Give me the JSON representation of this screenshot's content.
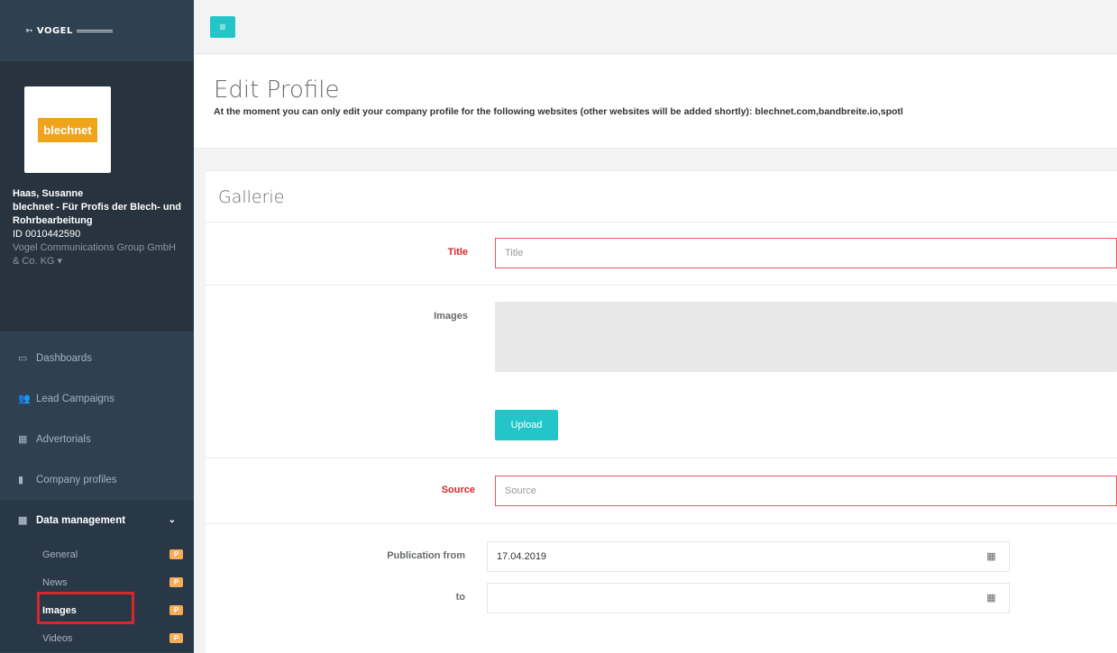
{
  "sidebar": {
    "logo_text": "VOGEL",
    "company_logo_text": "blechnet",
    "user": {
      "name": "Haas, Susanne",
      "company": "blechnet - Für Profis der Blech- und Rohrbearbeitung",
      "id": "ID 0010442590",
      "org": "Vogel Communications Group GmbH & Co. KG"
    },
    "nav": [
      {
        "label": "Dashboards",
        "icon": "monitor-icon"
      },
      {
        "label": "Lead Campaigns",
        "icon": "users-icon"
      },
      {
        "label": "Advertorials",
        "icon": "table-icon"
      },
      {
        "label": "Company profiles",
        "icon": "bar-chart-icon"
      },
      {
        "label": "Data management",
        "icon": "grid-icon"
      }
    ],
    "sub": [
      {
        "label": "General",
        "badge": "P"
      },
      {
        "label": "News",
        "badge": "P"
      },
      {
        "label": "Images",
        "badge": "P"
      },
      {
        "label": "Videos",
        "badge": "P"
      }
    ]
  },
  "header": {
    "title": "Edit Profile",
    "description": "At the moment you can only edit your company profile for the following websites (other websites will be added shortly): blechnet.com,bandbreite.io,spotl"
  },
  "form": {
    "section_title": "Gallerie",
    "title_label": "Title",
    "title_placeholder": "Title",
    "images_label": "Images",
    "upload_label": "Upload",
    "source_label": "Source",
    "source_placeholder": "Source",
    "pub_from_label": "Publication from",
    "pub_from_value": "17.04.2019",
    "to_label": "to",
    "to_value": ""
  },
  "colors": {
    "sidebar": "#2f4050",
    "accent": "#23c6c8",
    "error": "#ed5565",
    "badge": "#f8ac59",
    "highlight": "#d9262c"
  }
}
